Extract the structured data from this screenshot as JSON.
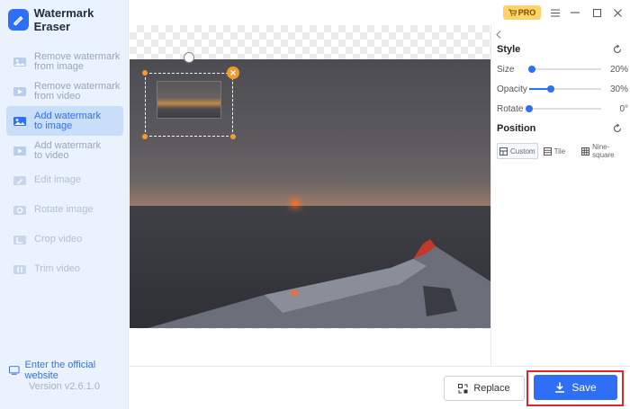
{
  "app": {
    "title": "Watermark Eraser",
    "version": "Version v2.6.1.0",
    "website_link": "Enter the official website"
  },
  "colors": {
    "accent": "#2f6ff5",
    "handle": "#f39a2b",
    "pro": "#ffd36a",
    "highlight_outline": "#e0262b"
  },
  "topbar": {
    "pro_label": "PRO"
  },
  "sidebar": {
    "items": [
      {
        "line1": "Remove watermark",
        "line2": "from image",
        "icon": "image-icon",
        "state": "normal"
      },
      {
        "line1": "Remove watermark",
        "line2": "from video",
        "icon": "video-icon",
        "state": "normal"
      },
      {
        "line1": "Add watermark",
        "line2": "to image",
        "icon": "image-add-icon",
        "state": "active"
      },
      {
        "line1": "Add watermark",
        "line2": "to video",
        "icon": "video-add-icon",
        "state": "normal"
      },
      {
        "line1": "Edit image",
        "line2": "",
        "icon": "edit-image-icon",
        "state": "disabled"
      },
      {
        "line1": "Rotate image",
        "line2": "",
        "icon": "rotate-image-icon",
        "state": "disabled"
      },
      {
        "line1": "Crop video",
        "line2": "",
        "icon": "crop-video-icon",
        "state": "disabled"
      },
      {
        "line1": "Trim video",
        "line2": "",
        "icon": "trim-video-icon",
        "state": "disabled"
      }
    ]
  },
  "panel": {
    "style_title": "Style",
    "sliders": [
      {
        "label": "Size",
        "value_text": "20%",
        "value": 0.02
      },
      {
        "label": "Opacity",
        "value_text": "30%",
        "value": 0.3
      },
      {
        "label": "Rotate",
        "value_text": "0°",
        "value": 0.0
      }
    ],
    "position_title": "Position",
    "position_options": [
      {
        "label": "Custom",
        "icon": "custom-layout-icon",
        "selected": true
      },
      {
        "label": "Tile",
        "icon": "tile-layout-icon",
        "selected": false
      },
      {
        "label": "Nine-square",
        "label_line1": "Nine-",
        "label_line2": "square",
        "icon": "grid-layout-icon",
        "selected": false
      }
    ]
  },
  "bottombar": {
    "replace_label": "Replace",
    "save_label": "Save"
  }
}
